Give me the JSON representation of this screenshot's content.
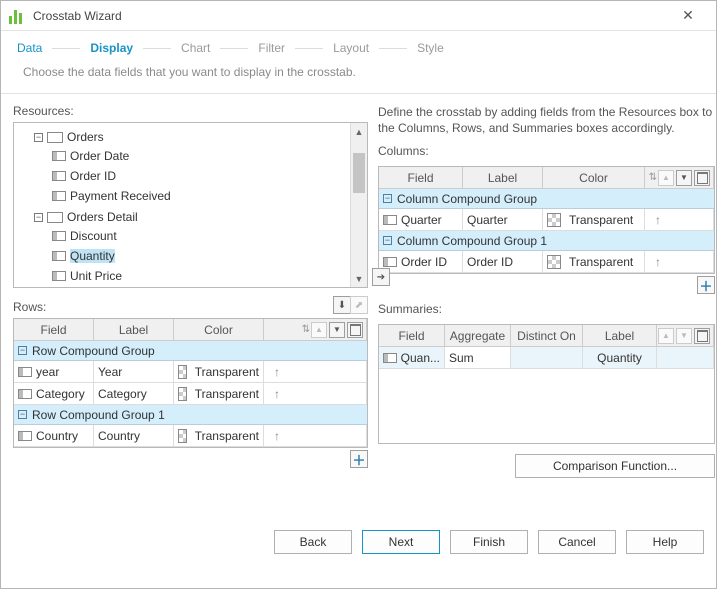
{
  "window": {
    "title": "Crosstab Wizard"
  },
  "steps": [
    "Data",
    "Display",
    "Chart",
    "Filter",
    "Layout",
    "Style"
  ],
  "active_step": 1,
  "description": "Choose the data fields that you want to display in the crosstab.",
  "right_info": "Define the crosstab by adding fields from the Resources box to the Columns, Rows, and Summaries boxes accordingly.",
  "labels": {
    "resources": "Resources:",
    "rows": "Rows:",
    "columns": "Columns:",
    "summaries": "Summaries:",
    "field": "Field",
    "label": "Label",
    "color": "Color",
    "aggregate": "Aggregate",
    "distinct": "Distinct On",
    "comparison": "Comparison Function..."
  },
  "resources_tree": {
    "orders": {
      "name": "Orders",
      "children": [
        "Order Date",
        "Order ID",
        "Payment Received"
      ]
    },
    "orders_detail": {
      "name": "Orders Detail",
      "children": [
        "Discount",
        "Quantity",
        "Unit Price"
      ]
    },
    "selected": "Quantity"
  },
  "rows": {
    "groups": [
      {
        "title": "Row Compound Group",
        "items": [
          {
            "field": "year",
            "label": "Year",
            "color": "Transparent"
          },
          {
            "field": "Category",
            "label": "Category",
            "color": "Transparent"
          }
        ]
      },
      {
        "title": "Row Compound Group 1",
        "items": [
          {
            "field": "Country",
            "label": "Country",
            "color": "Transparent"
          }
        ]
      }
    ]
  },
  "columns": {
    "groups": [
      {
        "title": "Column Compound Group",
        "items": [
          {
            "field": "Quarter",
            "label": "Quarter",
            "color": "Transparent"
          }
        ]
      },
      {
        "title": "Column Compound Group 1",
        "items": [
          {
            "field": "Order ID",
            "label": "Order ID",
            "color": "Transparent"
          }
        ]
      }
    ]
  },
  "summaries": [
    {
      "field": "Quan...",
      "aggregate": "Sum",
      "distinct": "",
      "label": "Quantity"
    }
  ],
  "footer": {
    "back": "Back",
    "next": "Next",
    "finish": "Finish",
    "cancel": "Cancel",
    "help": "Help"
  }
}
